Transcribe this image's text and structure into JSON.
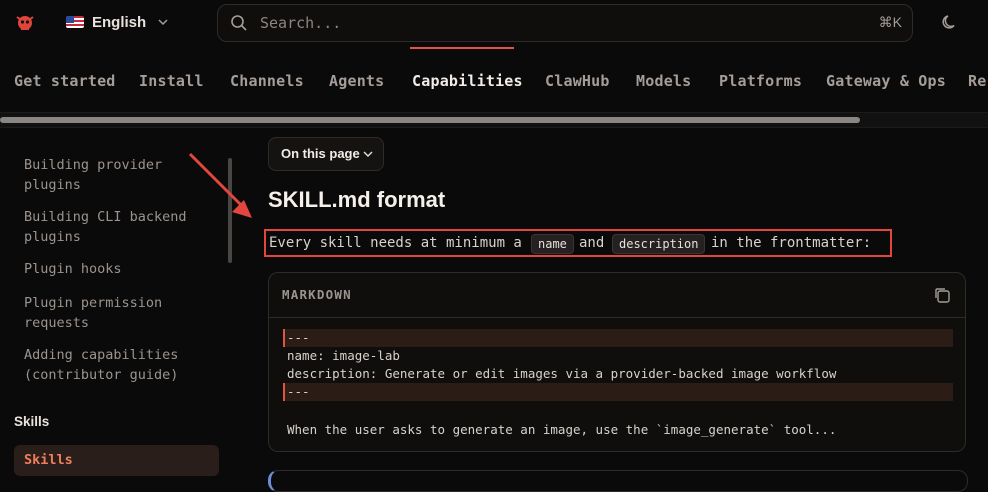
{
  "header": {
    "language": "English",
    "search_placeholder": "Search...",
    "search_shortcut": "⌘K"
  },
  "tabs": [
    {
      "label": "Get started"
    },
    {
      "label": "Install"
    },
    {
      "label": "Channels"
    },
    {
      "label": "Agents"
    },
    {
      "label": "Capabilities",
      "active": true
    },
    {
      "label": "ClawHub"
    },
    {
      "label": "Models"
    },
    {
      "label": "Platforms"
    },
    {
      "label": "Gateway & Ops"
    },
    {
      "label": "Re"
    }
  ],
  "sidebar": {
    "items": [
      {
        "label": "Building provider plugins"
      },
      {
        "label": "Building CLI backend plugins"
      },
      {
        "label": "Plugin hooks"
      },
      {
        "label": "Plugin permission requests"
      },
      {
        "label": "Adding capabilities (contributor guide)"
      }
    ],
    "section_heading": "Skills",
    "active_item": "Skills"
  },
  "main": {
    "on_this_page": "On this page",
    "heading": "SKILL.md format",
    "paragraph": {
      "part1": "Every skill needs at minimum a",
      "code1": "name",
      "part2": "and",
      "code2": "description",
      "part3": "in the frontmatter:"
    },
    "codeblock": {
      "language_label": "MARKDOWN",
      "lines": [
        "---",
        "name: image-lab",
        "description: Generate or edit images via a provider-backed image workflow",
        "---",
        "",
        "When the user asks to generate an image, use the `image_generate` tool..."
      ]
    }
  },
  "colors": {
    "accent": "#e0553f",
    "background": "#0b0a0a",
    "annotation": "#e2463f"
  }
}
